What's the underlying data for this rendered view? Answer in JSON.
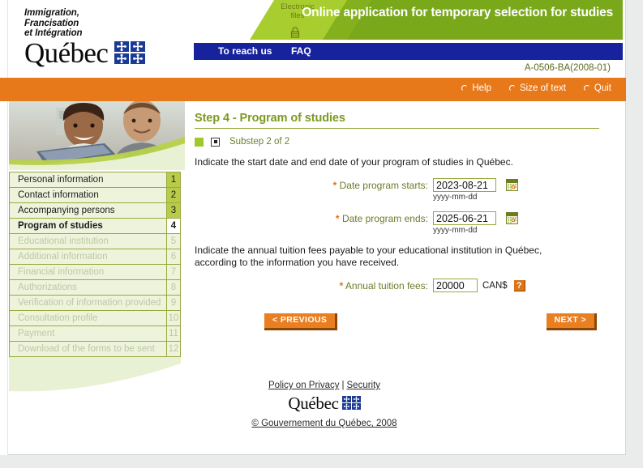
{
  "header": {
    "ministry_lines": [
      "Immigration,",
      "Francisation",
      "et Intégration"
    ],
    "wordmark": "Québec",
    "electronic_files_label": "Electronic\nfiles",
    "banner_title": "Online application for temporary selection for studies",
    "nav": {
      "reach_us": "To reach us",
      "faq": "FAQ"
    },
    "form_code": "A-0506-BA(2008-01)"
  },
  "toolbar": {
    "items": [
      {
        "label": "Help",
        "icon": "radio-icon"
      },
      {
        "label": "Size of text",
        "icon": "radio-icon"
      },
      {
        "label": "Quit",
        "icon": "radio-icon"
      }
    ]
  },
  "sidebar": {
    "items": [
      {
        "label": "Personal information",
        "number": "1",
        "state": "done"
      },
      {
        "label": "Contact information",
        "number": "2",
        "state": "done"
      },
      {
        "label": "Accompanying persons",
        "number": "3",
        "state": "done"
      },
      {
        "label": "Program of studies",
        "number": "4",
        "state": "active"
      },
      {
        "label": "Educational institution",
        "number": "5",
        "state": "disabled"
      },
      {
        "label": "Additional information",
        "number": "6",
        "state": "disabled"
      },
      {
        "label": "Financial information",
        "number": "7",
        "state": "disabled"
      },
      {
        "label": "Authorizations",
        "number": "8",
        "state": "disabled"
      },
      {
        "label": "Verification of information provided",
        "number": "9",
        "state": "disabled"
      },
      {
        "label": "Consultation profile",
        "number": "10",
        "state": "disabled"
      },
      {
        "label": "Payment",
        "number": "11",
        "state": "disabled"
      },
      {
        "label": "Download of the forms to be sent",
        "number": "12",
        "state": "disabled"
      }
    ]
  },
  "main": {
    "step_title": "Step 4 - Program of studies",
    "substep_label": "Substep 2 of 2",
    "paragraph_dates": "Indicate the start date and end date of your program of studies in Québec.",
    "paragraph_fees": "Indicate the annual tuition fees payable to your educational institution in Québec, according to the information you have received.",
    "fields": {
      "start_date": {
        "label": "Date program starts:",
        "required_marker": "*",
        "value": "2023-08-21",
        "placeholder": "yyyy-mm-dd",
        "hint": "yyyy-mm-dd",
        "calendar_icon": "calendar-icon"
      },
      "end_date": {
        "label": "Date program ends:",
        "required_marker": "*",
        "value": "2025-06-21",
        "placeholder": "yyyy-mm-dd",
        "hint": "yyyy-mm-dd",
        "calendar_icon": "calendar-icon"
      },
      "tuition": {
        "label": "Annual tuition fees:",
        "required_marker": "*",
        "value": "20000",
        "placeholder": "",
        "currency": "CAN$",
        "help_glyph": "?"
      }
    },
    "buttons": {
      "previous": "< PREVIOUS",
      "next": "NEXT >"
    }
  },
  "footer": {
    "policy_link": "Policy on Privacy",
    "separator": "|",
    "security_link": "Security",
    "wordmark": "Québec",
    "copyright": "© Gouvernement du Québec, 2008"
  },
  "colors": {
    "orange": "#e8791b",
    "green_accent": "#8ba531",
    "banner_green_light": "#a7cd2e",
    "banner_green_dark": "#6f9a17",
    "navy": "#17239c",
    "nav_badge_green": "#b8cc49",
    "nav_row_bg": "#eef3dc",
    "label_olive": "#6a7d27",
    "required_star": "#e0701a"
  }
}
